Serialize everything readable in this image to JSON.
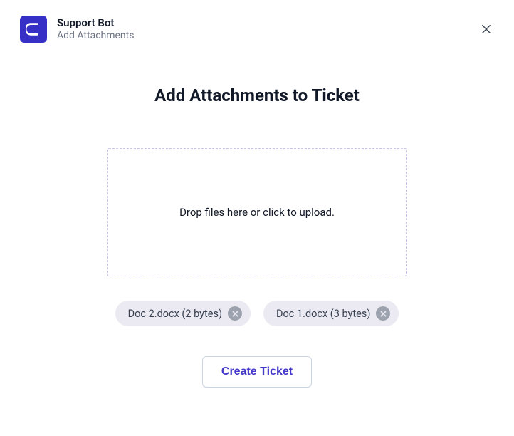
{
  "header": {
    "title": "Support Bot",
    "subtitle": "Add Attachments"
  },
  "main": {
    "title": "Add Attachments to Ticket",
    "dropzone_text": "Drop files here or click to upload."
  },
  "attachments": [
    {
      "label": "Doc 2.docx (2 bytes)"
    },
    {
      "label": "Doc 1.docx (3 bytes)"
    }
  ],
  "actions": {
    "create_label": "Create Ticket"
  }
}
